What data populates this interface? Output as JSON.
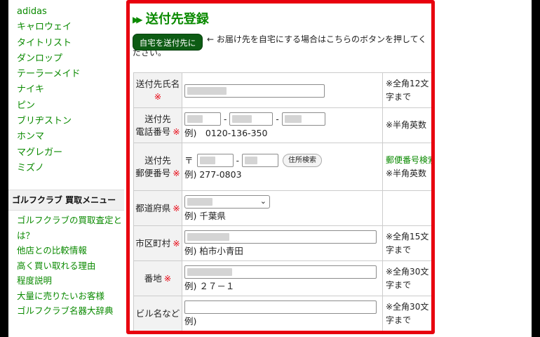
{
  "sidebar": {
    "brands": [
      "adidas",
      "キャロウェイ",
      "タイトリスト",
      "ダンロップ",
      "テーラーメイド",
      "ナイキ",
      "ピン",
      "ブリヂストン",
      "ホンマ",
      "マグレガー",
      "ミズノ"
    ],
    "buy_menu_title": "ゴルフクラブ 買取メニュー",
    "buy_menu_items": [
      "ゴルフクラブの買取査定とは？",
      "他店との比較情報",
      "高く買い取れる理由",
      "程度説明",
      "大量に売りたいお客様",
      "ゴルフクラブ名器大辞典"
    ]
  },
  "form": {
    "title": "送付先登録",
    "home_button": "自宅を送付先に",
    "home_note": "← お届け先を自宅にする場合はこちらのボタンを押してください。",
    "required_mark": "※",
    "rows": {
      "name": {
        "label": "送付先氏名",
        "note": "※全角12文字まで"
      },
      "phone": {
        "label1": "送付先",
        "label2": "電話番号",
        "example": "例)　0120-136-350",
        "note": "※半角英数"
      },
      "zip": {
        "label1": "送付先",
        "label2": "郵便番号",
        "prefix": "〒",
        "button": "住所検索",
        "example": "例) 277-0803",
        "link": "郵便番号検索",
        "note": "※半角英数"
      },
      "pref": {
        "label": "都道府県",
        "example": "例) 千葉県"
      },
      "city": {
        "label": "市区町村",
        "example": "例) 柏市小青田",
        "note": "※全角15文字まで"
      },
      "street": {
        "label": "番地",
        "example": "例) ２７－１",
        "note": "※全角30文字まで"
      },
      "building": {
        "label": "ビル名など",
        "example": "例)",
        "note": "※全角30文字まで"
      }
    }
  },
  "colors": {
    "accent_green": "#0a8a00",
    "frame_red": "#e8000e",
    "button_green": "#0d5c14"
  }
}
